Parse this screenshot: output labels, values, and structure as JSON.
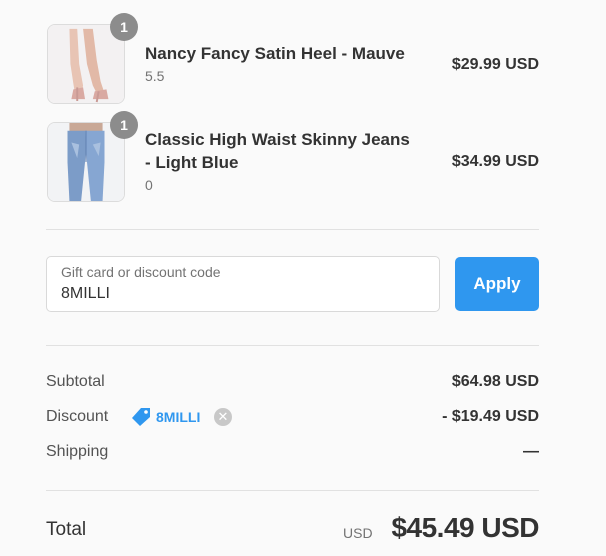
{
  "items": [
    {
      "name": "Nancy Fancy Satin Heel - Mauve",
      "variant": "5.5",
      "quantity": "1",
      "price": "$29.99 USD"
    },
    {
      "name": "Classic High Waist Skinny Jeans - Light Blue",
      "variant": "0",
      "quantity": "1",
      "price": "$34.99 USD"
    }
  ],
  "discount": {
    "placeholder": "Gift card or discount code",
    "value": "8MILLI",
    "apply_label": "Apply"
  },
  "summary": {
    "subtotal_label": "Subtotal",
    "subtotal_value": "$64.98 USD",
    "discount_label": "Discount",
    "discount_code": "8MILLI",
    "discount_value": "- $19.49 USD",
    "shipping_label": "Shipping",
    "shipping_value": "—"
  },
  "total": {
    "label": "Total",
    "currency": "USD",
    "amount": "$45.49 USD"
  },
  "colors": {
    "accent": "#2f97ef",
    "badge": "#8c8c8c",
    "background": "#fafafa"
  }
}
